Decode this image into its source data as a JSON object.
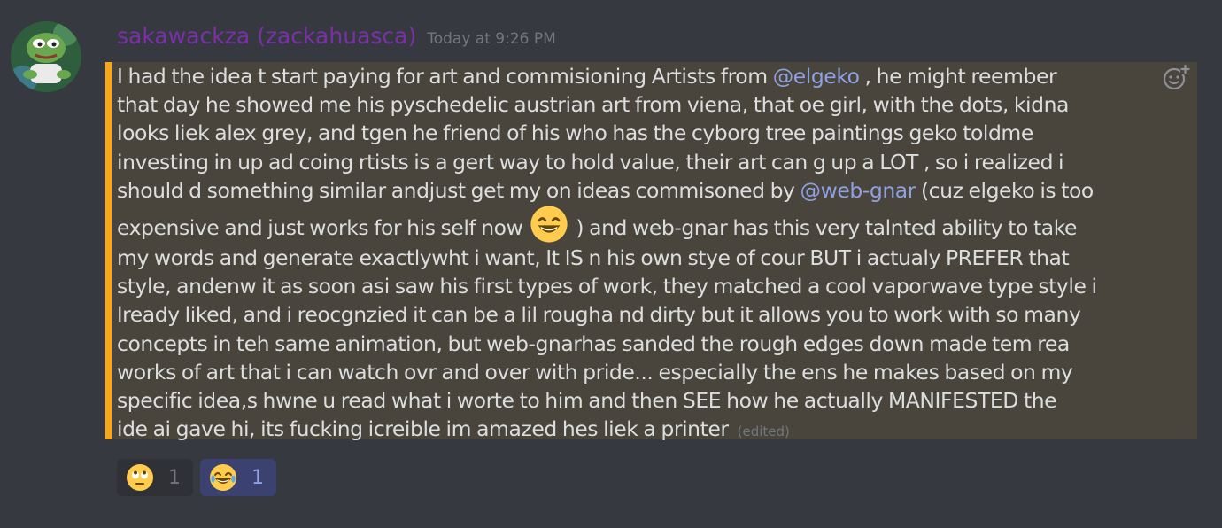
{
  "message": {
    "username": "sakawackza (zackahuasca)",
    "timestamp": "Today at 9:26 PM",
    "lines": [
      {
        "a": "I had the idea t start paying for art and commisioning Artists from ",
        "mention": "@elgeko",
        "b": " , he might reember"
      },
      {
        "t": "that day he showed me his pyschedelic austrian art from viena, that oe girl, with the dots, kidna"
      },
      {
        "t": "looks liek alex grey, and tgen he friend of his who has the cyborg tree paintings geko toldme"
      },
      {
        "t": "investing in up ad coing rtists is a gert way to hold value, their art can g up a LOT , so i realized i"
      },
      {
        "a": "should d something similar andjust get my on ideas commisoned by ",
        "mention": "@web-gnar",
        "b": " (cuz elgeko is too"
      },
      {
        "a": "expensive and just works for his self now ",
        "emoji": "grinning-face-emoji",
        "b": " ) and web-gnar has this very talnted ability to take"
      },
      {
        "t": "my words and generate exactlywht i want, It IS n his own stye of cour BUT i actualy PREFER that"
      },
      {
        "t": "style, andenw it as soon asi saw his first types of work, they matched a cool vaporwave type style i"
      },
      {
        "t": "lready liked, and i reocgnzied it can be a lil rougha nd dirty but it allows you to work with so many"
      },
      {
        "t": "concepts in teh same animation, but web-gnarhas sanded the rough edges down made tem rea"
      },
      {
        "t": "works of art that i can watch ovr and over with pride... especially the ens he makes based on my"
      },
      {
        "t": "specific idea,s hwne u read what i worte to him and then SEE how he actually MANIFESTED the"
      },
      {
        "t": "ide ai gave hi, its fucking icreible im amazed hes liek a printer"
      }
    ],
    "edited_label": "(edited)",
    "add_reaction_icon": "add-reaction-icon"
  },
  "reactions": [
    {
      "emoji": "face-with-rolling-eyes-emoji",
      "count": "1",
      "me": false
    },
    {
      "emoji": "face-with-tears-of-joy-emoji",
      "count": "1",
      "me": true
    }
  ],
  "colors": {
    "background": "#36393f",
    "username": "#7b2fa8",
    "mention": "#8ea1e1",
    "highlight_bg": "#49443c",
    "highlight_bar": "#faa61a"
  }
}
